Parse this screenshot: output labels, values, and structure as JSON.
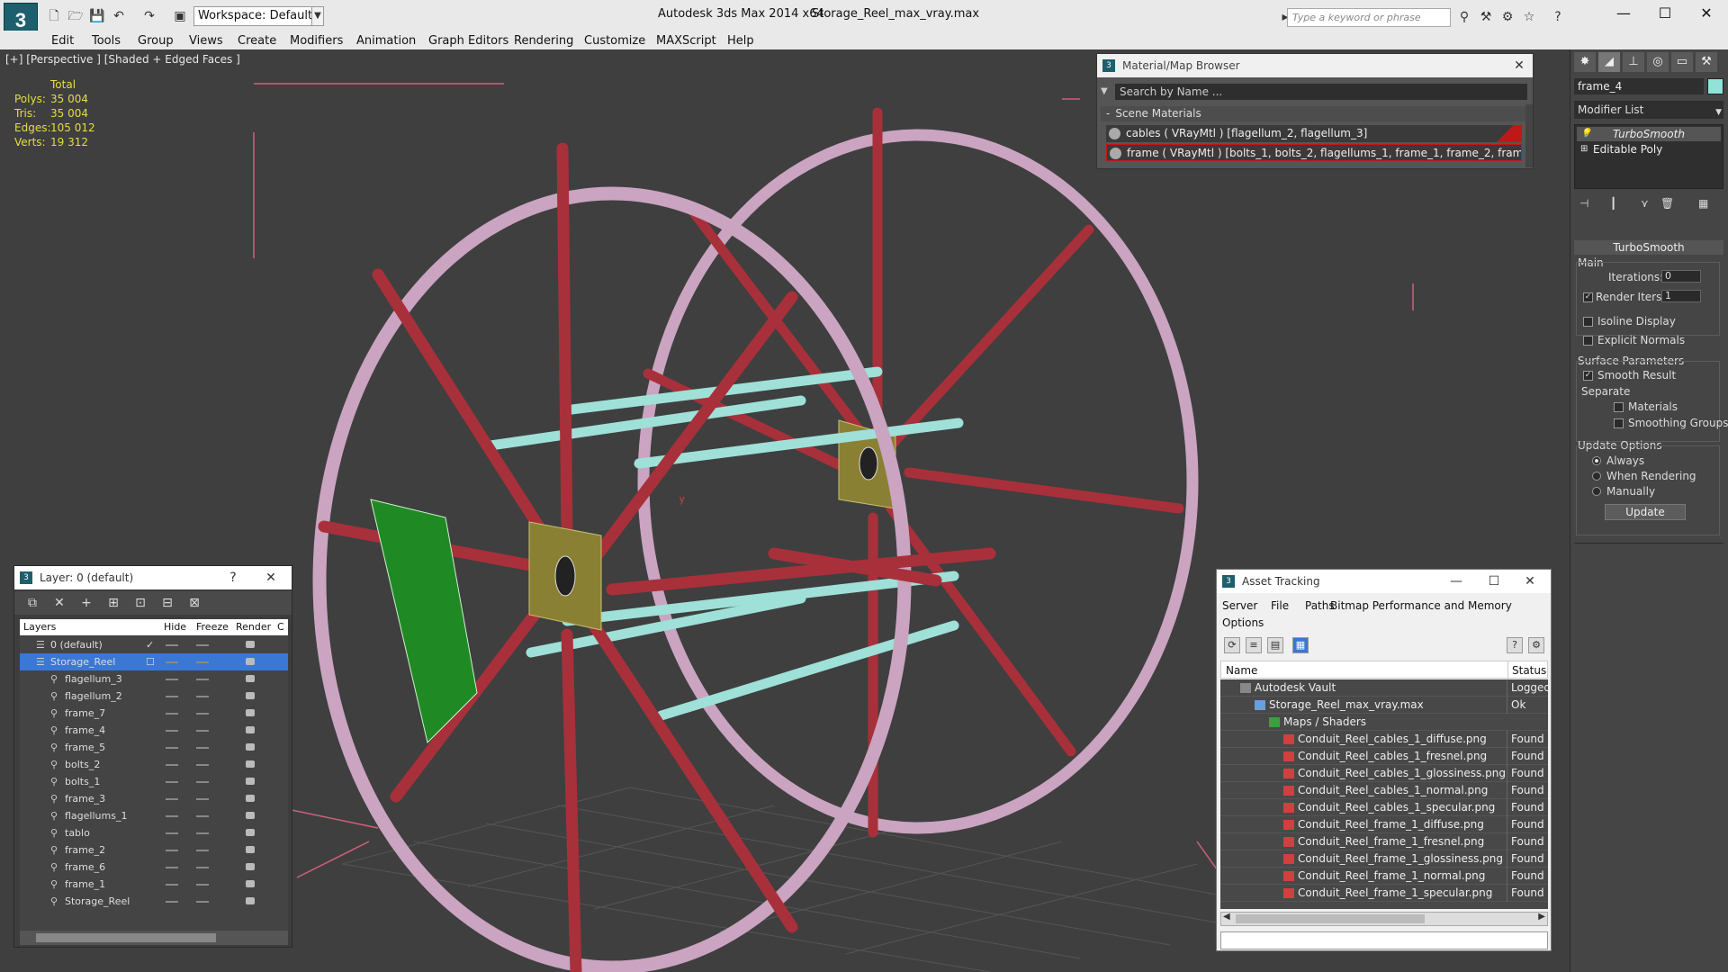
{
  "app": {
    "title": "Autodesk 3ds Max  2014 x64",
    "file": "Storage_Reel_max_vray.max",
    "workspace": "Workspace: Default",
    "search_placeholder": "Type a keyword or phrase"
  },
  "menu": [
    "Edit",
    "Tools",
    "Group",
    "Views",
    "Create",
    "Modifiers",
    "Animation",
    "Graph Editors",
    "Rendering",
    "Customize",
    "MAXScript",
    "Help"
  ],
  "viewport": {
    "label": "[+] [Perspective ] [Shaded + Edged Faces ]",
    "stats": {
      "header": "Total",
      "rows": [
        {
          "label": "Polys:",
          "value": "35 004"
        },
        {
          "label": "Tris:",
          "value": "35 004"
        },
        {
          "label": "Edges:",
          "value": "105 012"
        },
        {
          "label": "Verts:",
          "value": "19 312"
        }
      ]
    },
    "axis_label": "y"
  },
  "material_browser": {
    "title": "Material/Map Browser",
    "search": "Search by Name ...",
    "section": "Scene Materials",
    "materials": [
      "cables  ( VRayMtl )  [flagellum_2, flagellum_3]",
      "frame  ( VRayMtl )  [bolts_1, bolts_2, flagellums_1, frame_1, frame_2, frame_3, fr..."
    ]
  },
  "layer_explorer": {
    "title": "Layer: 0 (default)",
    "help": "?",
    "columns": [
      "Layers",
      "Hide",
      "Freeze",
      "Render",
      "C"
    ],
    "rows": [
      {
        "name": "0 (default)",
        "level": 0
      },
      {
        "name": "Storage_Reel",
        "level": 0
      },
      {
        "name": "flagellum_3",
        "level": 1
      },
      {
        "name": "flagellum_2",
        "level": 1
      },
      {
        "name": "frame_7",
        "level": 1
      },
      {
        "name": "frame_4",
        "level": 1
      },
      {
        "name": "frame_5",
        "level": 1
      },
      {
        "name": "bolts_2",
        "level": 1
      },
      {
        "name": "bolts_1",
        "level": 1
      },
      {
        "name": "frame_3",
        "level": 1
      },
      {
        "name": "flagellums_1",
        "level": 1
      },
      {
        "name": "tablo",
        "level": 1
      },
      {
        "name": "frame_2",
        "level": 1
      },
      {
        "name": "frame_6",
        "level": 1
      },
      {
        "name": "frame_1",
        "level": 1
      },
      {
        "name": "Storage_Reel",
        "level": 1
      }
    ]
  },
  "asset_tracking": {
    "title": "Asset Tracking",
    "menu": [
      "Server",
      "File",
      "Paths",
      "Bitmap Performance and Memory",
      "Options"
    ],
    "columns": [
      "Name",
      "Status"
    ],
    "rows": [
      {
        "name": "Autodesk Vault",
        "status": "Logged Out",
        "level": 0
      },
      {
        "name": "Storage_Reel_max_vray.max",
        "status": "Ok",
        "level": 1
      },
      {
        "name": "Maps / Shaders",
        "status": "",
        "level": 2
      },
      {
        "name": "Conduit_Reel_cables_1_diffuse.png",
        "status": "Found",
        "level": 3
      },
      {
        "name": "Conduit_Reel_cables_1_fresnel.png",
        "status": "Found",
        "level": 3
      },
      {
        "name": "Conduit_Reel_cables_1_glossiness.png",
        "status": "Found",
        "level": 3
      },
      {
        "name": "Conduit_Reel_cables_1_normal.png",
        "status": "Found",
        "level": 3
      },
      {
        "name": "Conduit_Reel_cables_1_specular.png",
        "status": "Found",
        "level": 3
      },
      {
        "name": "Conduit_Reel_frame_1_diffuse.png",
        "status": "Found",
        "level": 3
      },
      {
        "name": "Conduit_Reel_frame_1_fresnel.png",
        "status": "Found",
        "level": 3
      },
      {
        "name": "Conduit_Reel_frame_1_glossiness.png",
        "status": "Found",
        "level": 3
      },
      {
        "name": "Conduit_Reel_frame_1_normal.png",
        "status": "Found",
        "level": 3
      },
      {
        "name": "Conduit_Reel_frame_1_specular.png",
        "status": "Found",
        "level": 3
      }
    ]
  },
  "command_panel": {
    "object_name": "frame_4",
    "object_color": "#8fe3d9",
    "modifier_list": "Modifier List",
    "stack": [
      "TurboSmooth",
      "Editable Poly"
    ],
    "rollout": "TurboSmooth",
    "main": "Main",
    "iterations_label": "Iterations:",
    "iterations": "0",
    "render_iters_label": "Render Iters:",
    "render_iters": "1",
    "isoline": "Isoline Display",
    "explicit_normals": "Explicit Normals",
    "surface_params": "Surface Parameters",
    "smooth_result": "Smooth Result",
    "separate": "Separate",
    "materials": "Materials",
    "smoothing_groups": "Smoothing Groups",
    "update_options": "Update Options",
    "always": "Always",
    "when_rendering": "When Rendering",
    "manually": "Manually",
    "update_button": "Update"
  }
}
